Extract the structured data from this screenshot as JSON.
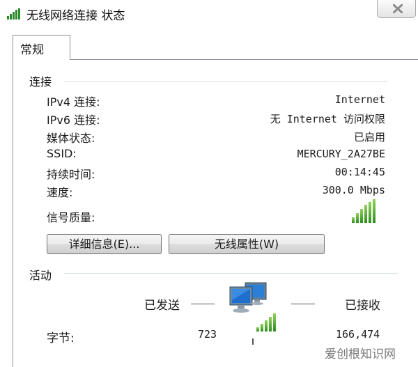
{
  "window": {
    "title": "无线网络连接 状态",
    "close_icon": "close-icon"
  },
  "tabs": [
    {
      "label": "常规",
      "active": true
    }
  ],
  "connection": {
    "heading": "连接",
    "rows": [
      {
        "label": "IPv4 连接:",
        "value": "Internet"
      },
      {
        "label": "IPv6 连接:",
        "value": "无 Internet 访问权限"
      },
      {
        "label": "媒体状态:",
        "value": "已启用"
      },
      {
        "label": "SSID:",
        "value": "MERCURY_2A27BE"
      },
      {
        "label": "持续时间:",
        "value": "00:14:45"
      },
      {
        "label": "速度:",
        "value": "300.0 Mbps"
      }
    ],
    "signal_label": "信号质量:",
    "signal_level": 1.0,
    "signal_icon": "signal-strength-icon"
  },
  "buttons": {
    "details": "详细信息(E)...",
    "wireless_properties": "无线属性(W)"
  },
  "activity": {
    "heading": "活动",
    "sent_label": "已发送",
    "received_label": "已接收",
    "bytes_label": "字节:",
    "bytes_sent": "723",
    "bytes_received": "166,474",
    "network_icon": "network-computers-icon"
  },
  "watermark": "爱创根知识网",
  "colors": {
    "signal_green": "#2f8d1e",
    "border": "#898c95"
  }
}
